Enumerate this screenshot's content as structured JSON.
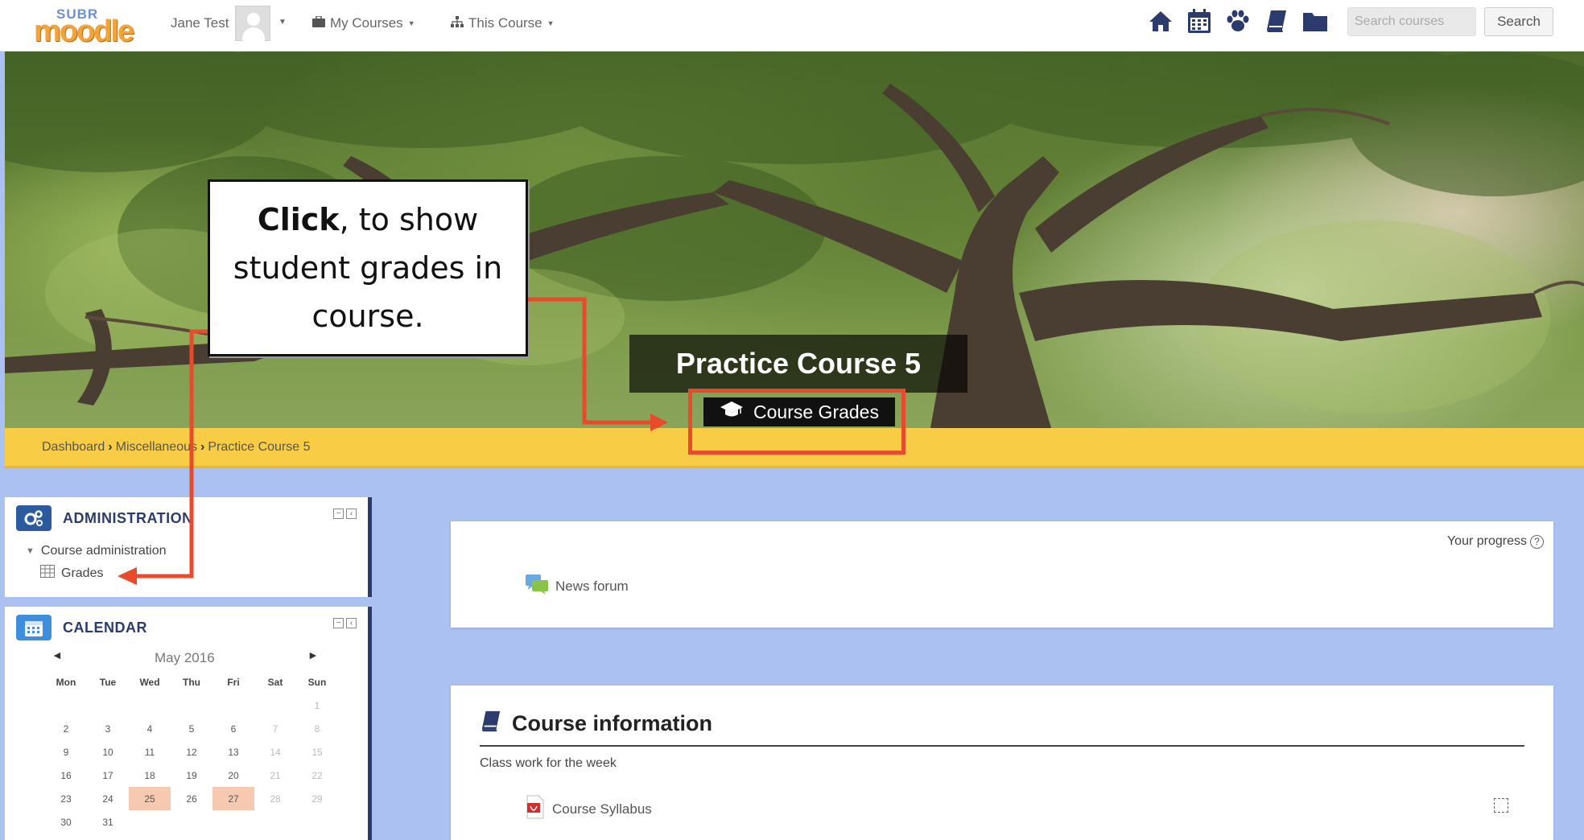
{
  "navbar": {
    "logo_small": "SUBR",
    "logo_big": "moodle",
    "user_name": "Jane Test",
    "my_courses": "My Courses",
    "this_course": "This Course",
    "search_placeholder": "Search courses",
    "search_label": "Search",
    "icons": [
      "home-icon",
      "calendar-icon",
      "paw-icon",
      "book-icon",
      "folder-icon"
    ]
  },
  "hero": {
    "course_title": "Practice Course 5",
    "grades_button": "Course Grades"
  },
  "breadcrumb": [
    "Dashboard",
    "Miscellaneous",
    "Practice Course 5"
  ],
  "admin_block": {
    "title": "ADMINISTRATION",
    "course_admin": "Course administration",
    "grades": "Grades"
  },
  "calendar_block": {
    "title": "CALENDAR",
    "month": "May 2016",
    "prev": "◄",
    "next": "►",
    "weekdays": [
      "Mon",
      "Tue",
      "Wed",
      "Thu",
      "Fri",
      "Sat",
      "Sun"
    ],
    "weeks": [
      [
        "",
        "",
        "",
        "",
        "",
        "",
        "1"
      ],
      [
        "2",
        "3",
        "4",
        "5",
        "6",
        "7",
        "8"
      ],
      [
        "9",
        "10",
        "11",
        "12",
        "13",
        "14",
        "15"
      ],
      [
        "16",
        "17",
        "18",
        "19",
        "20",
        "21",
        "22"
      ],
      [
        "23",
        "24",
        "25",
        "26",
        "27",
        "28",
        "29"
      ],
      [
        "30",
        "31",
        "",
        "",
        "",
        "",
        ""
      ]
    ],
    "event_days": [
      "25",
      "27"
    ]
  },
  "main": {
    "progress_label": "Your progress",
    "news_forum": "News forum",
    "info_title": "Course information",
    "info_desc": "Class work for the week",
    "syllabus": "Course Syllabus"
  },
  "annotation": {
    "bold": "Click",
    "rest": ", to show student grades in course."
  },
  "colors": {
    "breadcrumb_bar": "#f8cd45",
    "page_bg": "#aac1f2",
    "block_accent": "#2c3b6e",
    "annotation_red": "#e84b2c"
  }
}
